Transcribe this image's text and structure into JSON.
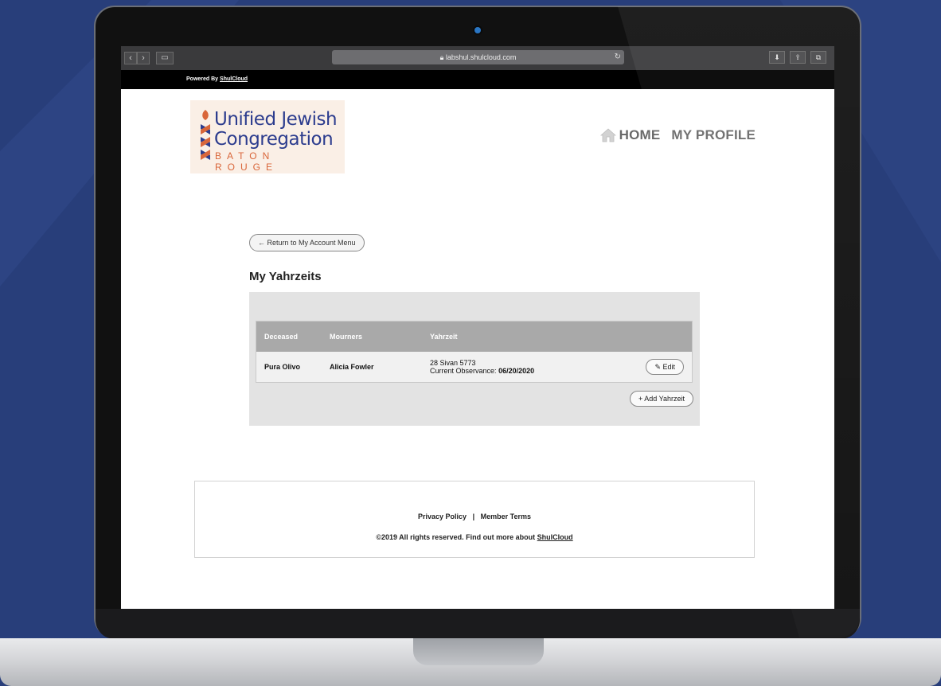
{
  "browser": {
    "url": "labshul.shulcloud.com",
    "back_icon": "chevron-left-icon",
    "forward_icon": "chevron-right-icon"
  },
  "powered": {
    "prefix": "Powered By",
    "link": "ShulCloud"
  },
  "logo": {
    "line1": "Unified Jewish",
    "line2": "Congregation",
    "line3": "BATON ROUGE"
  },
  "nav": {
    "home": "HOME",
    "profile": "MY PROFILE"
  },
  "content": {
    "return_button": "← Return to My Account Menu",
    "title": "My Yahrzeits",
    "table": {
      "headers": [
        "Deceased",
        "Mourners",
        "Yahrzeit"
      ],
      "rows": [
        {
          "deceased": "Pura Olivo",
          "mourners": "Alicia Fowler",
          "yahrzeit_date": "28 Sivan 5773",
          "observance_label": "Current Observance:",
          "observance_date": "06/20/2020",
          "edit_label": "✎ Edit"
        }
      ]
    },
    "add_button": "+ Add Yahrzeit"
  },
  "footer": {
    "privacy": "Privacy Policy",
    "separator": "|",
    "terms": "Member Terms",
    "copyright": "©2019 All rights reserved. Find out more about",
    "copyright_link": "ShulCloud"
  },
  "colors": {
    "background": "#283e7a",
    "logo_blue": "#2c3c8e",
    "logo_orange": "#d9663a",
    "table_header": "#a9a9a9"
  }
}
